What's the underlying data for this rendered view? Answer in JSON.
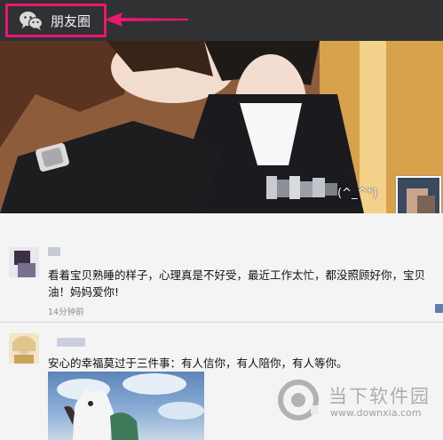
{
  "header": {
    "title": "朋友圈",
    "icon": "wechat-icon",
    "highlight_color": "#e8196e",
    "background": "#2f3133"
  },
  "cover": {
    "name_suffix": "(^_^*)"
  },
  "posts": [
    {
      "text_line1": "看着宝贝熟睡的样子，心理真是不好受，最近工作太忙，都没照顾好你，宝贝",
      "text_line2": "油！妈妈爱你!",
      "time": "14分钟前"
    },
    {
      "text_line1": "安心的幸福莫过于三件事：有人信你，有人陪你，有人等你。"
    }
  ],
  "watermark": {
    "name": "当下软件园",
    "url": "www.downxia.com"
  }
}
